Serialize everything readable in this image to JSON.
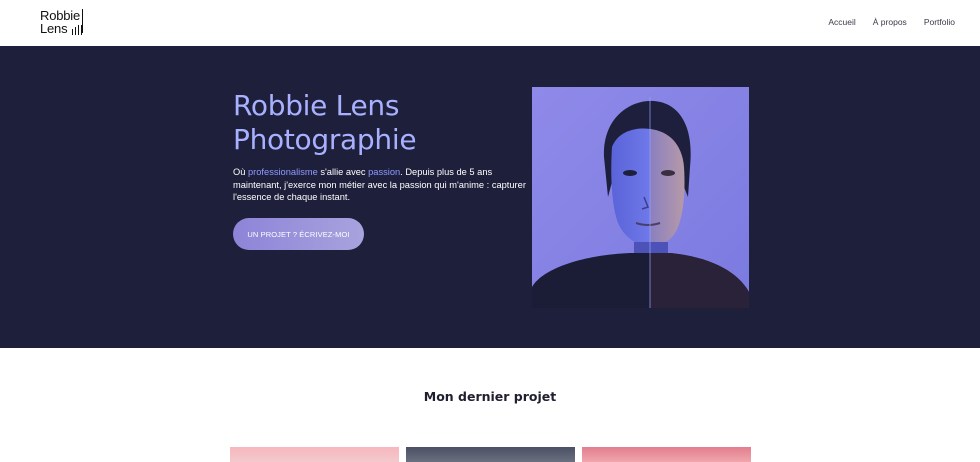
{
  "header": {
    "logo": {
      "line1": "Robbie",
      "line2": "Lens"
    },
    "nav": [
      {
        "label": "Accueil"
      },
      {
        "label": "À propos"
      },
      {
        "label": "Portfolio"
      }
    ]
  },
  "hero": {
    "title": "Robbie Lens Photographie",
    "description": {
      "p1": "Où ",
      "h1": "professionalisme",
      "p2": " s'allie avec ",
      "h2": "passion",
      "p3": ". Depuis plus de 5 ans maintenant, j'exerce mon métier avec la passion qui m'anime : capturer l'essence de chaque instant."
    },
    "cta_label": "UN PROJET ? ÉCRIVEZ-MOI"
  },
  "project": {
    "title": "Mon dernier projet"
  },
  "colors": {
    "hero_bg": "#1e1f3b",
    "accent": "#a7b1ff",
    "cta": "#9a93db"
  }
}
